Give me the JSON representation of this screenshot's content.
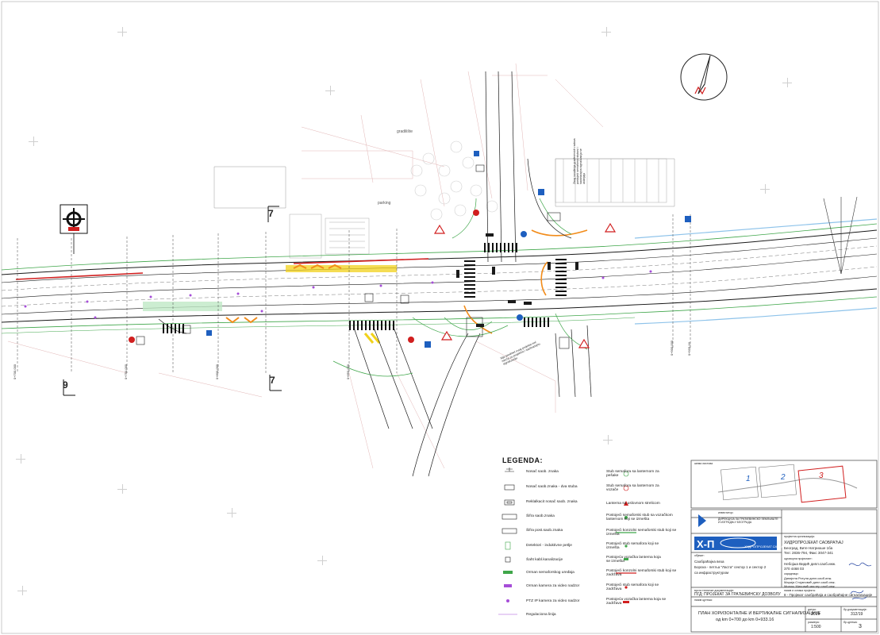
{
  "legend": {
    "title": "LEGENDA:",
    "left_items": [
      "Nosač saob. znaka",
      "Nosač saob.znaka - dva stuba",
      "Reklalkacit nosač saob. znaka",
      "Šifra saob.znaka",
      "Šifra post.saob.znaka",
      "Detektori - induktivne petlje",
      "Šaht kabl.kanalizacije",
      "Orman semaforskog uređaja",
      "Orman kamera za video nadzor",
      "PTZ IP kamera za video nadzor",
      "Regulaciona linija"
    ],
    "right_items": [
      "Stub semafora sa lanternom za pešake",
      "Stub semafora sa lanternom za vozače",
      "Lanterna sa uslovnom strelicom",
      "Postojeći semaforski stub sa vozačkom lanternom koji se izmešta",
      "Postojeći konzolni semaforski stub koji se izmešta",
      "Postojeći stub semafora koji se izmešta",
      "Postojeća vozačka lanterna koja se izmešta",
      "Postojeći konzolni semaforski stub koji se zadržava",
      "Postojeći stub semafora koji se zadržava",
      "Postojeća vozačka lanterna koja se zadržava"
    ]
  },
  "map_labels": {
    "parking": "parking",
    "gradiliste": "gradilište",
    "note_north": "Zbog izvođenja građevinskih radova postojeći semaforski stubovi i saobraćajna signalizacija se uklanjaju",
    "note_south": "Nije predmet ovog projekta već mreža za projektnu i saobraćajnu signalizaciju"
  },
  "key_plan": {
    "title": "шема листова",
    "sheets": [
      "1",
      "2",
      "3"
    ]
  },
  "title_block": {
    "investor_label": "инвеститор:",
    "investor": "ДИРЕКЦИЈА ЗА ГРАЂЕВИНСКО ЗЕМЉИШТЕ И ИЗГРАДЊУ БЕОГРАДА",
    "company_label": "пројектна организација:",
    "company": "ХИДРОПРОЈЕКАТ САОБРАЋАЈ",
    "address": "Београд, Вите Натриоше 1ба",
    "phone": "Тел: 2836-794, Факс 3047-341",
    "logo_text": "ХИДРОПРОЈЕКАТ САОБРАЋАЈ",
    "object_label": "објекат:",
    "object_lines": [
      "Саобраћајна веза",
      "Борска - петља \"Ласта\" сектор 1 и сектор 2",
      "са инфраструктуром"
    ],
    "chief_label": "одговорни пројектант:",
    "chief": "Небојша Видић дипл.саоб.инж.",
    "chief_license": "370 4468 03",
    "designers_label": "сарадници:",
    "designers": [
      "Данијела Ротула дипл.саоб.инж.",
      "Марија Стојановић дипл.саоб.инж.",
      "Милош Миловић мастер саоб.инж."
    ],
    "doc_type_label": "врста техничке документације:",
    "doc_type": "ПГД: ПРОЈЕКАТ ЗА ГРАЂЕВИНСКУ ДОЗВОЛУ",
    "project_label": "назив и ознака пројекта:",
    "project": "8 - Пројекат саобраћаја и саобраћајне сигнализације",
    "drawing_label": "назив цртежа:",
    "drawing_title": "ПЛАН ХОРИЗОНТАЛНЕ И ВЕРТИКАЛНЕ СИГНАЛИЗАЦИЈЕ",
    "drawing_range": "од km 0+700 до km 0+933.16",
    "date_label": "датум:",
    "date": "2019",
    "docnum_label": "бр.документације:",
    "docnum": "312/19",
    "scale_label": "размера:",
    "scale": "1:500",
    "sheet_label": "бр.цртежа:",
    "sheet": "3"
  },
  "section_marks": [
    "9",
    "7",
    "7"
  ],
  "chainages": [
    "0+700.000",
    "0+750.000",
    "0+800.000",
    "0+850.000",
    "0+900.000",
    "0+933.16"
  ],
  "colors": {
    "road": "#1a1a1a",
    "green_line": "#3fa64a",
    "red_line": "#d11f1f",
    "orange": "#f28c1a",
    "blue": "#1e5fbf",
    "purple": "#a64dd8",
    "yellow": "#f1d21b",
    "grey": "#9a9a9a"
  }
}
